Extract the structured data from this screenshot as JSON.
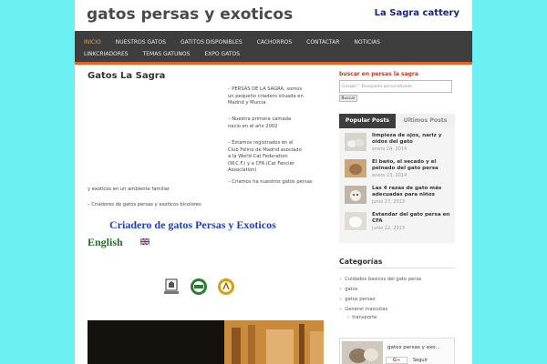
{
  "site": {
    "title": "gatos persas y exoticos",
    "tagline": "La Sagra cattery"
  },
  "nav": {
    "row1": [
      "INICIO",
      "NUESTROS GATOS",
      "GATITOS DISPONIBLES",
      "CACHORROS",
      "CONTACTAR",
      "NOTICIAS"
    ],
    "row2": [
      "LINKCRIADORES",
      "TEMAS GATUNOS",
      "EXPO GATOS"
    ],
    "active": "INICIO"
  },
  "post": {
    "title": "Gatos La Sagra",
    "p1": "– PERSAS DE LA SAGRA, somos un pequeño criadero situada en Madrid y Murcia",
    "p2": "– Nuestra primera camada nacio en el año 2002",
    "p3": "– Estamos registrados en el Club Felino de Madrid asociado a la World Cat Federation (W.C.F.) y a CFA (Cat Fancier Association)",
    "p4": "– Criamos ha nuestros gatos persas y exoticos en un ambiente familiar",
    "p5": "– Criadores de gatos persas y exoticos bicolores",
    "heading": "Criadero de gatos Persas y Exoticos",
    "english": "English",
    "logos": [
      "CLUB FELINO DE MADRID",
      "WCF",
      "CFA"
    ]
  },
  "sidebar": {
    "search_label": "buscar en persas la sagra",
    "search_placeholder": "Google™ Búsqueda personalizada",
    "search_button": "Buscar",
    "tabs": [
      "Popular Posts",
      "Ultimos Posts"
    ],
    "popular": [
      {
        "title": "limpieza de ojos, nariz y oidos del gato",
        "date": "enero 24, 2014"
      },
      {
        "title": "El baño, el secado y el peinado del gato persa",
        "date": "enero 23, 2014"
      },
      {
        "title": "Las 4 razas de gato más adecuadas para niños",
        "date": "junio 27, 2013"
      },
      {
        "title": "Estandar del gato persa en CFA",
        "date": "junio 22, 2013"
      }
    ],
    "categories_heading": "Categorías",
    "categories": [
      "Cuidados basicos del gato persa",
      "gatos",
      "gatos persas",
      "General mascotas",
      "transporte"
    ],
    "widget": {
      "name": "gatos persas y exo...",
      "gplus": "G+",
      "follow": "Seguir"
    }
  },
  "colors": {
    "background": "#6cf0f4",
    "nav": "#3e3e3e",
    "accent": "#e8621f",
    "tagline": "#1a237e",
    "heading": "#1f3fbf",
    "english": "#1a7a1a"
  }
}
